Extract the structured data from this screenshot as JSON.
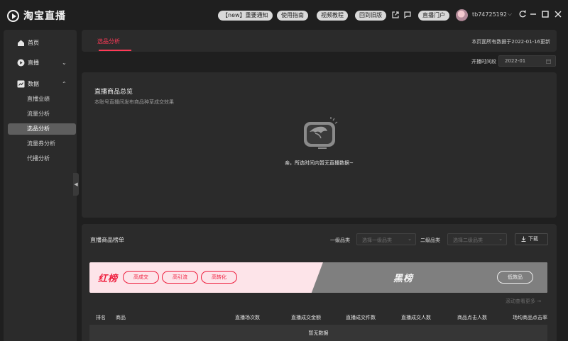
{
  "app": {
    "logo_text": "淘宝直播"
  },
  "topbar": {
    "pills": [
      "【new】重要通知",
      "使用指南",
      "视频教程",
      "回到旧版",
      "直播门户"
    ],
    "user_name": "tb74725192"
  },
  "sidebar": {
    "home": "首页",
    "live": "直播",
    "data": "数据",
    "sub_items": [
      "直播业绩",
      "流量分析",
      "选品分析",
      "流量券分析",
      "代播分析"
    ],
    "active_sub": "选品分析"
  },
  "tabs": {
    "active": "选品分析"
  },
  "update_note": "本页面所有数据于2022-01-16更新",
  "date_filter": {
    "label": "开播时间段",
    "value": "2022-01"
  },
  "overview": {
    "title": "直播商品总览",
    "subtitle": "本账号直播间发布商品种草成交效果",
    "empty_text": "亲，所选时间内暂无直播数据~"
  },
  "ranking": {
    "title": "直播商品榜单",
    "level1_label": "一级品类",
    "level1_placeholder": "选择一级品类",
    "level2_label": "二级品类",
    "level2_placeholder": "选择二级品类",
    "download": "下载",
    "red_title": "红榜",
    "red_pills": [
      "高成交",
      "高引流",
      "高转化"
    ],
    "black_title": "黑榜",
    "black_pill": "低效品",
    "scroll_hint": "滚动查看更多",
    "columns": [
      "排名",
      "商品",
      "直播场次数",
      "直播成交金额",
      "直播成交件数",
      "直播成交人数",
      "商品点击人数",
      "场均商品点击率"
    ],
    "no_data": "暂无数据"
  },
  "colors": {
    "accent": "#ff3a57",
    "red_board": "#ee1c3c",
    "red_bg": "#fde4e9",
    "black_bg": "#7f7f7f"
  }
}
